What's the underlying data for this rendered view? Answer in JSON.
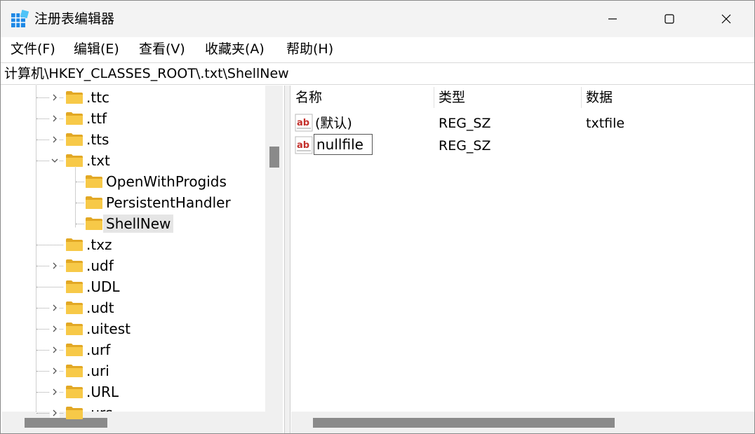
{
  "window": {
    "title": "注册表编辑器"
  },
  "menu": {
    "file": "文件(F)",
    "edit": "编辑(E)",
    "view": "查看(V)",
    "favorites": "收藏夹(A)",
    "help": "帮助(H)"
  },
  "address": "计算机\\HKEY_CLASSES_ROOT\\.txt\\ShellNew",
  "tree": {
    "items": [
      {
        "label": ".ttc",
        "expander": "collapsed"
      },
      {
        "label": ".ttf",
        "expander": "collapsed"
      },
      {
        "label": ".tts",
        "expander": "collapsed"
      },
      {
        "label": ".txt",
        "expander": "expanded"
      },
      {
        "label": "OpenWithProgids",
        "expander": "none"
      },
      {
        "label": "PersistentHandler",
        "expander": "none"
      },
      {
        "label": "ShellNew",
        "expander": "none",
        "selected": true
      },
      {
        "label": ".txz",
        "expander": "none"
      },
      {
        "label": ".udf",
        "expander": "collapsed"
      },
      {
        "label": ".UDL",
        "expander": "none"
      },
      {
        "label": ".udt",
        "expander": "collapsed"
      },
      {
        "label": ".uitest",
        "expander": "collapsed"
      },
      {
        "label": ".urf",
        "expander": "collapsed"
      },
      {
        "label": ".uri",
        "expander": "collapsed"
      },
      {
        "label": ".URL",
        "expander": "collapsed"
      },
      {
        "label": ".urs",
        "expander": "collapsed"
      }
    ]
  },
  "list": {
    "columns": {
      "name": "名称",
      "type": "类型",
      "data": "数据"
    },
    "rows": [
      {
        "name": "(默认)",
        "type": "REG_SZ",
        "data": "txtfile"
      },
      {
        "name": "nullfile",
        "type": "REG_SZ",
        "data": "",
        "renaming": true
      }
    ]
  },
  "colors": {
    "folder": "#f7c948",
    "folder_dark": "#e2a825",
    "selection": "#e5e5e5",
    "scroll_thumb": "#8a8a8a",
    "ab_icon_red": "#c4302b"
  }
}
